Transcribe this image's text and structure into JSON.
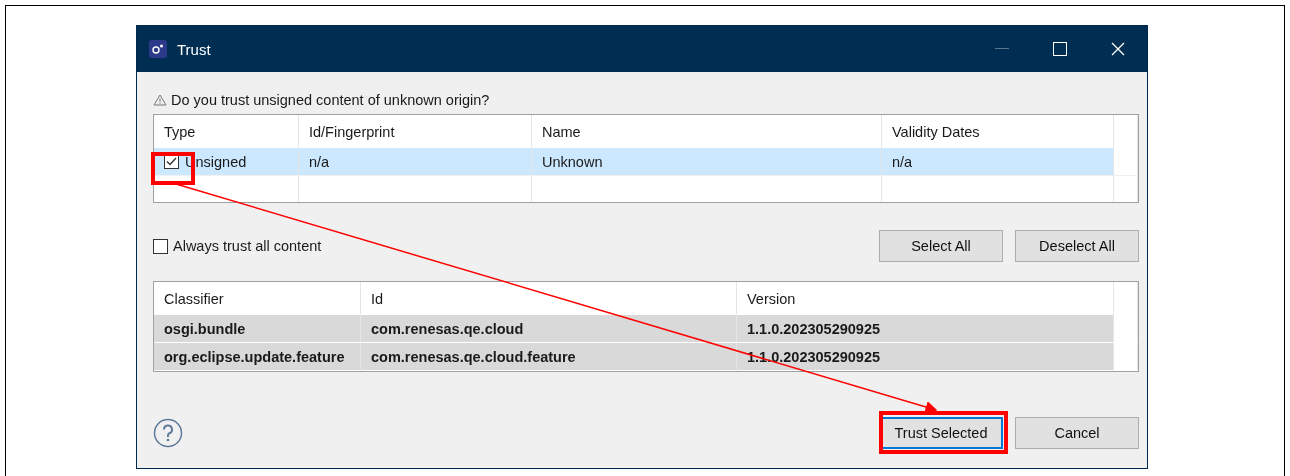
{
  "window": {
    "title": "Trust"
  },
  "question": "Do you trust unsigned content of unknown origin?",
  "signers": {
    "columns": [
      "Type",
      "Id/Fingerprint",
      "Name",
      "Validity Dates"
    ],
    "rows": [
      {
        "checked": true,
        "selected": true,
        "cells": [
          "Unsigned",
          "n/a",
          "Unknown",
          "n/a"
        ]
      }
    ]
  },
  "always_trust": {
    "label": "Always trust all content",
    "checked": false
  },
  "select_buttons": [
    "Select All",
    "Deselect All"
  ],
  "artifacts": {
    "columns": [
      "Classifier",
      "Id",
      "Version"
    ],
    "rows": [
      {
        "selected": true,
        "cells": [
          "osgi.bundle",
          "com.renesas.qe.cloud",
          "1.1.0.202305290925"
        ]
      },
      {
        "selected": true,
        "cells": [
          "org.eclipse.update.feature",
          "com.renesas.qe.cloud.feature",
          "1.1.0.202305290925"
        ]
      }
    ]
  },
  "buttons": [
    {
      "label": "Trust Selected",
      "default": true
    },
    {
      "label": "Cancel",
      "default": false
    }
  ]
}
